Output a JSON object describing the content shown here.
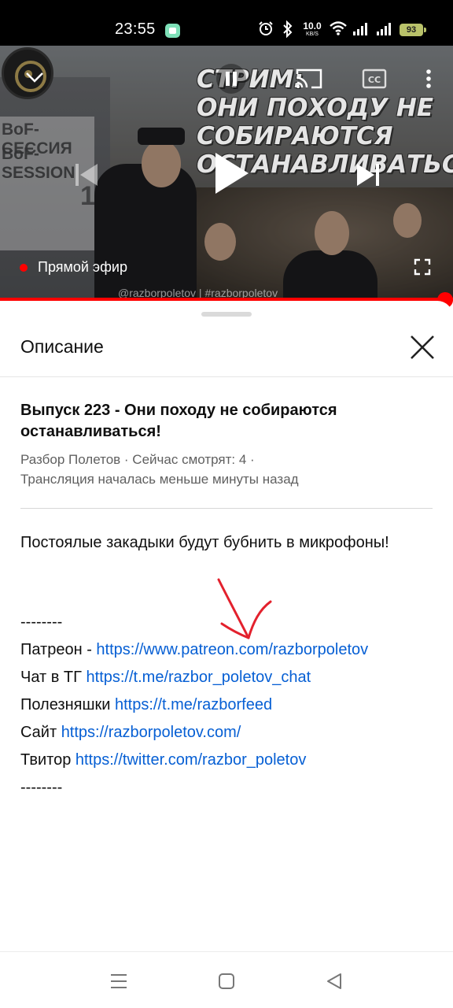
{
  "status_bar": {
    "time": "23:55",
    "net_speed_value": "10.0",
    "net_speed_unit": "KB/S",
    "battery": "93",
    "icons": [
      "app-notification-icon",
      "alarm-icon",
      "bluetooth-icon",
      "wifi-icon",
      "signal-icon",
      "signal-icon-2",
      "battery-icon"
    ]
  },
  "player": {
    "overlay_title": "СТРИМ:\nОНИ ПОХОДУ НЕ\nСОБИРАЮТСЯ\nОСТАНАВЛИВАТЬСЯ!",
    "banner_line1": "BoF-СЕССИЯ",
    "banner_line2": "BoF-SESSION",
    "banner_num": "1",
    "watermark": "@razborpoletov  |  #razborpoletov",
    "live_label": "Прямой эфир",
    "live_color": "#ff0000",
    "icons": [
      "chevron-down-icon",
      "pause-icon",
      "cast-icon",
      "captions-icon",
      "more-vert-icon",
      "skip-previous-icon",
      "play-icon",
      "skip-next-icon",
      "fullscreen-icon"
    ]
  },
  "sheet": {
    "title": "Описание",
    "video_title": "Выпуск 223 -  Они походу не собираются останавливаться!",
    "meta_line1": "Разбор Полетов · Сейчас смотрят: 4 ·",
    "meta_line2": "Трансляция началась меньше минуты назад",
    "description": "Постоялые закадыки будут бубнить в микрофоны!",
    "separator": "--------",
    "links": [
      {
        "label": "Патреон - ",
        "url": "https://www.patreon.com/razborpoletov"
      },
      {
        "label": "Чат в ТГ ",
        "url": "https://t.me/razbor_poletov_chat"
      },
      {
        "label": "Полезняшки ",
        "url": "https://t.me/razborfeed"
      },
      {
        "label": "Сайт ",
        "url": "https://razborpoletov.com/"
      },
      {
        "label": "Твитор ",
        "url": "https://twitter.com/razbor_poletov"
      }
    ],
    "link_color": "#065fd4",
    "annotation_color": "#e3212d"
  },
  "nav_bar": {
    "icons": [
      "menu-icon",
      "home-icon",
      "back-icon"
    ]
  }
}
